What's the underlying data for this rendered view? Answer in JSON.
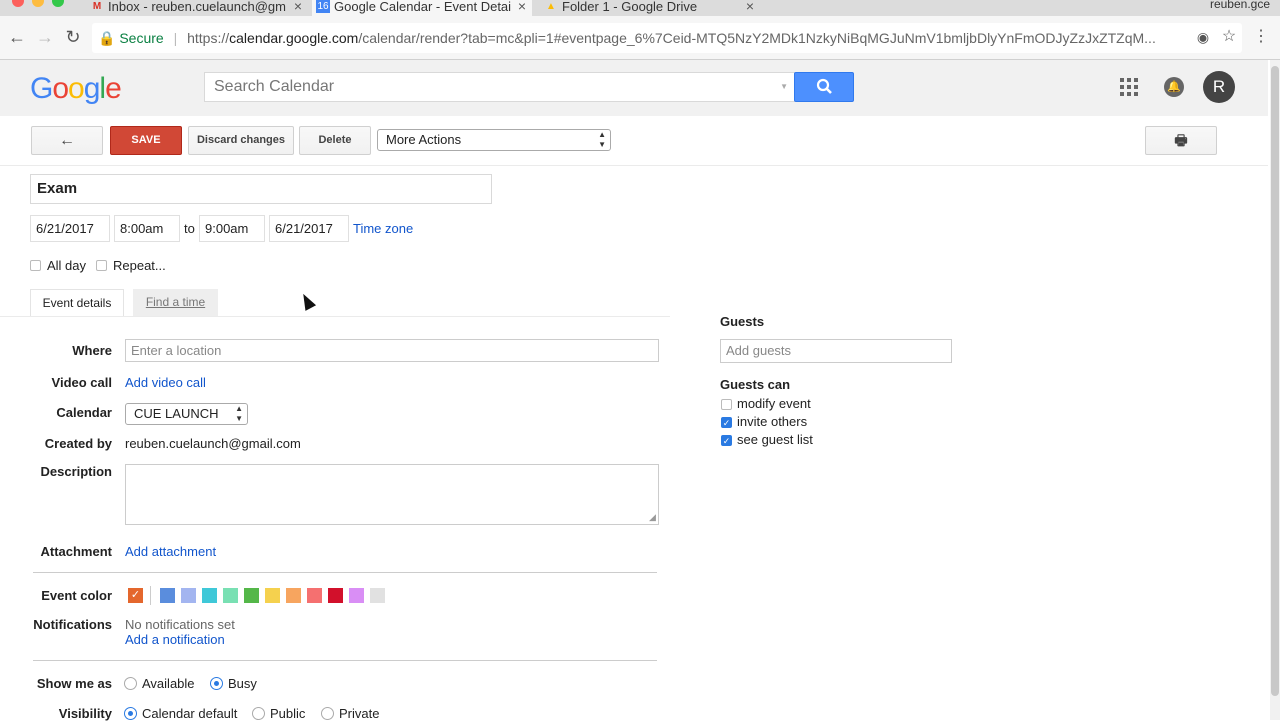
{
  "browser": {
    "tabs": [
      {
        "title": "Inbox - reuben.cuelaunch@gm",
        "icon": "gmail-icon",
        "icon_text": "M"
      },
      {
        "title": "Google Calendar - Event Detai",
        "icon": "calendar-icon",
        "icon_text": "16"
      },
      {
        "title": "Folder 1 - Google Drive",
        "icon": "drive-icon",
        "icon_text": "▲"
      }
    ],
    "profile_name": "reuben.gce",
    "secure_label": "Secure",
    "url_scheme": "https://",
    "url_host": "calendar.google.com",
    "url_path": "/calendar/render?tab=mc&pli=1#eventpage_6%7Ceid-MTQ5NzY2MDk1NzkyNiBqMGJuNmV1bmljbDlyYnFmODJyZzJxZTZqM..."
  },
  "header": {
    "logo": [
      "G",
      "o",
      "o",
      "g",
      "l",
      "e"
    ],
    "logo_colors": [
      "#4285f4",
      "#ea4335",
      "#fbbc05",
      "#4285f4",
      "#34a853",
      "#ea4335"
    ],
    "search_placeholder": "Search Calendar",
    "avatar_letter": "R"
  },
  "toolbar": {
    "back_label": "←",
    "save_label": "SAVE",
    "discard_label": "Discard changes",
    "delete_label": "Delete",
    "more_actions_label": "More Actions",
    "print_label": "🖶"
  },
  "event": {
    "title": "Exam",
    "start_date": "6/21/2017",
    "start_time": "8:00am",
    "to_label": "to",
    "end_time": "9:00am",
    "end_date": "6/21/2017",
    "time_zone_label": "Time zone",
    "all_day_label": "All day",
    "repeat_label": "Repeat..."
  },
  "tabs": {
    "event_details": "Event details",
    "find_a_time": "Find a time"
  },
  "details": {
    "where_label": "Where",
    "where_placeholder": "Enter a location",
    "video_call_label": "Video call",
    "add_video_call": "Add video call",
    "calendar_label": "Calendar",
    "calendar_value": "CUE LAUNCH",
    "created_by_label": "Created by",
    "created_by_value": "reuben.cuelaunch@gmail.com",
    "description_label": "Description",
    "attachment_label": "Attachment",
    "add_attachment": "Add attachment",
    "event_color_label": "Event color",
    "colors": [
      "#e4672d",
      "#5a8ddd",
      "#a3b5f0",
      "#3fc8d8",
      "#79e0b3",
      "#54b749",
      "#f5d14e",
      "#f7a55f",
      "#f57070",
      "#d2102b",
      "#d98ef5",
      "#e1e1e1"
    ],
    "notifications_label": "Notifications",
    "no_notifications": "No notifications set",
    "add_notification": "Add a notification",
    "show_me_as_label": "Show me as",
    "available_label": "Available",
    "busy_label": "Busy",
    "visibility_label": "Visibility",
    "calendar_default_label": "Calendar default",
    "public_label": "Public",
    "private_label": "Private"
  },
  "guests": {
    "heading": "Guests",
    "add_placeholder": "Add guests",
    "guests_can_label": "Guests can",
    "modify_event": "modify event",
    "invite_others": "invite others",
    "see_guest_list": "see guest list"
  }
}
